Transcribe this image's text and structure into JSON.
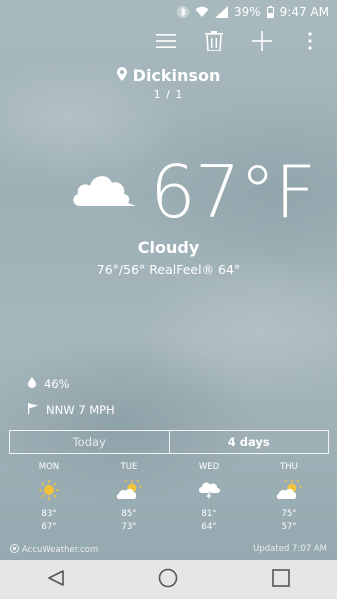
{
  "status": {
    "battery": "39%",
    "time": "9:47 AM",
    "icons": [
      "bluetooth-icon",
      "wifi-icon",
      "signal-icon",
      "battery-icon"
    ]
  },
  "toolbar": {
    "icons": [
      "list-icon",
      "trash-icon",
      "add-icon",
      "more-icon"
    ]
  },
  "location": {
    "name": "Dickinson",
    "page": "1 / 1"
  },
  "current": {
    "temp": "67",
    "unit": "°F",
    "condition": "Cloudy",
    "hilo": "76°/56° RealFeel® 64°",
    "icon": "cloud-icon"
  },
  "stats": {
    "humidity": "46%",
    "wind": "NNW 7 MPH"
  },
  "tabs": {
    "today": "Today",
    "four_days": "4 days"
  },
  "forecast": [
    {
      "day": "MON",
      "icon": "sunny-icon",
      "hi": "83°",
      "lo": "67°"
    },
    {
      "day": "TUE",
      "icon": "partly-cloudy-icon",
      "hi": "85°",
      "lo": "73°"
    },
    {
      "day": "WED",
      "icon": "thunderstorm-icon",
      "hi": "81°",
      "lo": "64°"
    },
    {
      "day": "THU",
      "icon": "partly-cloudy-icon",
      "hi": "75°",
      "lo": "57°"
    }
  ],
  "footer": {
    "brand": "AccuWeather.com",
    "updated": "Updated 7:07 AM"
  },
  "colors": {
    "background": "#9fb1b8",
    "sun": "#f5c33b",
    "navbar": "#e6e6e6",
    "nav_icon": "#555555"
  }
}
